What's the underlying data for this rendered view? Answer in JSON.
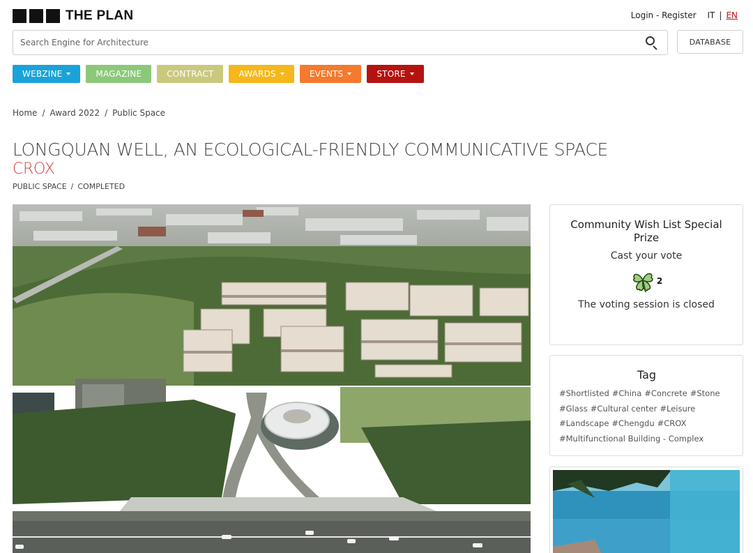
{
  "header": {
    "logo_text": "THE PLAN",
    "login_register": "Login - Register",
    "lang_it": "IT",
    "lang_sep": "|",
    "lang_en": "EN"
  },
  "search": {
    "placeholder": "Search Engine for Architecture",
    "icon": "search-icon"
  },
  "database_button": "DATABASE",
  "nav": [
    {
      "label": "WEBZINE",
      "color": "#1aa3d9",
      "dropdown": true
    },
    {
      "label": "MAGAZINE",
      "color": "#8cc87a",
      "dropdown": false
    },
    {
      "label": "CONTRACT",
      "color": "#c9c97e",
      "dropdown": false
    },
    {
      "label": "AWARDS",
      "color": "#f5b71b",
      "dropdown": true
    },
    {
      "label": "EVENTS",
      "color": "#f47a2d",
      "dropdown": true
    },
    {
      "label": "STORE",
      "color": "#b5130f",
      "dropdown": true
    }
  ],
  "breadcrumb": {
    "home": "Home",
    "award": "Award 2022",
    "current": "Public Space",
    "sep": "/"
  },
  "article": {
    "title": "LONGQUAN WELL, AN ECOLOGICAL-FRIENDLY COMMUNICATIVE SPACE",
    "author": "CROX",
    "category": "PUBLIC SPACE",
    "sep": "/",
    "status": "COMPLETED"
  },
  "vote_card": {
    "title": "Community Wish List Special Prize",
    "cast": "Cast your vote",
    "icon": "clover-icon",
    "count": "2",
    "closed": "The voting session is closed"
  },
  "tags_card": {
    "title": "Tag",
    "tags": [
      "#Shortlisted",
      "#China",
      "#Concrete",
      "#Stone",
      "#Glass",
      "#Cultural center",
      "#Leisure",
      "#Landscape",
      "#Chengdu",
      "#CROX",
      "#Multifunctional Building - Complex"
    ]
  }
}
